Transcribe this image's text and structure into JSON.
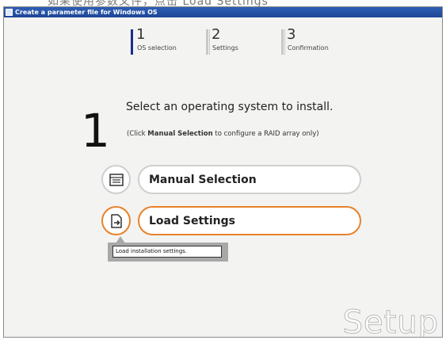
{
  "top_strip_text": "如果使用参数文件，点击 Load Settings",
  "window": {
    "title": "Create a parameter file for Windows OS",
    "icon": "app-window-icon"
  },
  "steps": [
    {
      "number": "1",
      "label": "OS selection",
      "active": true
    },
    {
      "number": "2",
      "label": "Settings",
      "active": false
    },
    {
      "number": "3",
      "label": "Confirmation",
      "active": false
    }
  ],
  "main": {
    "step_number": "1",
    "heading": "Select an operating system to install.",
    "subtext_prefix": "(Click ",
    "subtext_bold": "Manual Selection",
    "subtext_suffix": " to configure a RAID array only)"
  },
  "buttons": {
    "manual": {
      "label": "Manual Selection",
      "icon": "list-document-icon",
      "border_color": "#cfcfcf"
    },
    "load": {
      "label": "Load Settings",
      "icon": "import-file-icon",
      "border_color": "#e8822a"
    }
  },
  "tooltip": "Load installation settings.",
  "watermark": "Setup"
}
